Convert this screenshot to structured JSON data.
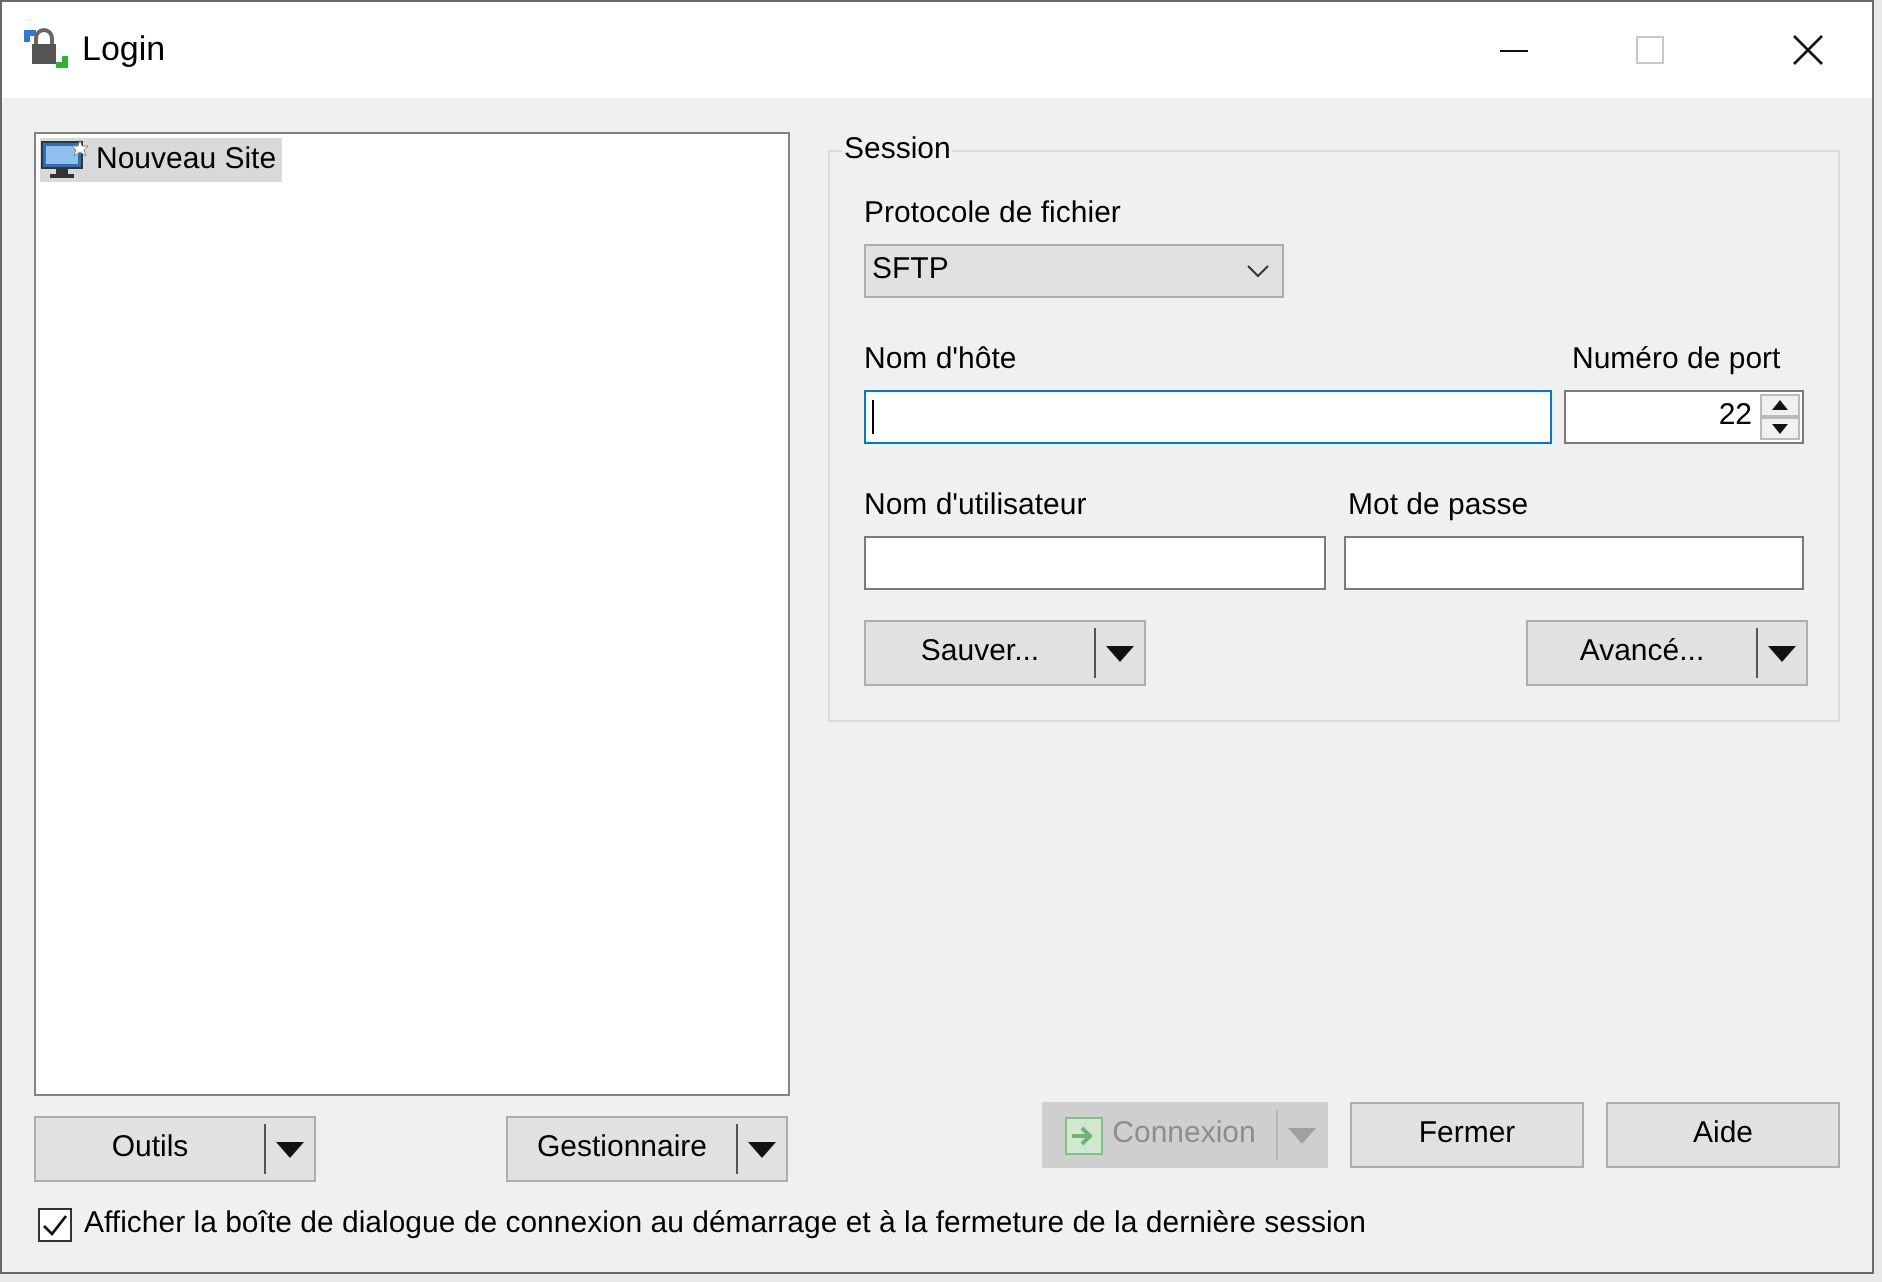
{
  "window": {
    "title": "Login",
    "maximize_disabled": true
  },
  "site_tree": {
    "items": [
      {
        "label": "Nouveau Site",
        "selected": true
      }
    ]
  },
  "session": {
    "legend": "Session",
    "protocol": {
      "label": "Protocole de fichier",
      "value": "SFTP"
    },
    "host": {
      "label": "Nom d'hôte",
      "focused": true
    },
    "port": {
      "label": "Numéro de port",
      "value": "22"
    },
    "username": {
      "label": "Nom d'utilisateur"
    },
    "password": {
      "label": "Mot de passe"
    },
    "buttons": [
      {
        "label": "Sauver...",
        "dropdown": true,
        "disabled": false
      },
      {
        "label": "Avancé...",
        "dropdown": true,
        "disabled": false
      }
    ]
  },
  "left_buttons": [
    {
      "label": "Outils",
      "dropdown": true,
      "disabled": false
    },
    {
      "label": "Gestionnaire",
      "dropdown": true,
      "disabled": false
    }
  ],
  "right_buttons": [
    {
      "label": "Connexion",
      "dropdown": true,
      "disabled": true,
      "kind": "with_icon"
    },
    {
      "label": "Fermer",
      "dropdown": false,
      "disabled": false
    },
    {
      "label": "Aide",
      "dropdown": false,
      "disabled": false
    }
  ],
  "startup_checkbox": {
    "label": "Afficher la boîte de dialogue de connexion au démarrage et à la fermeture de la dernière session",
    "checked": true
  }
}
